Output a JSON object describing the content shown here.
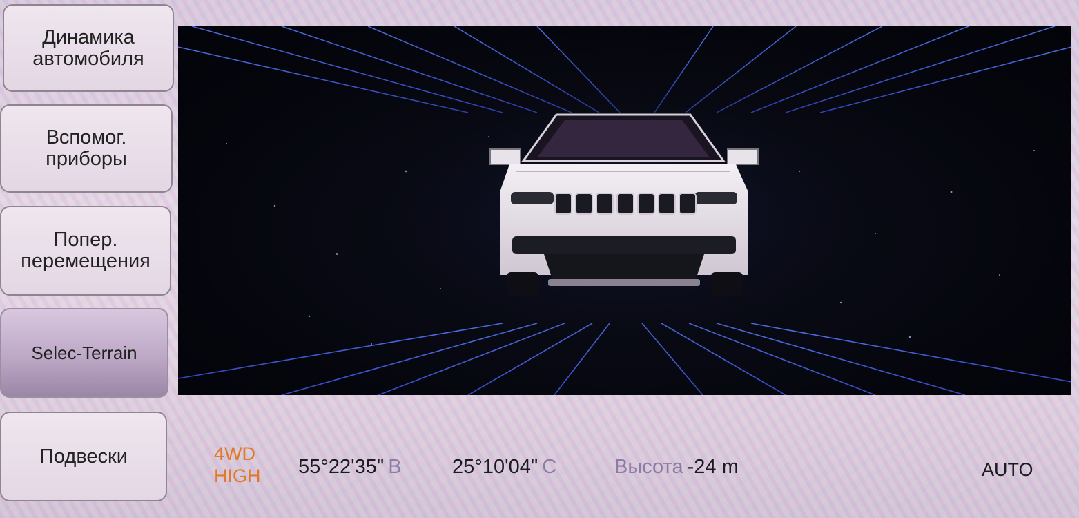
{
  "sidebar": {
    "items": [
      {
        "label_line1": "Динамика",
        "label_line2": "автомобиля",
        "active": false
      },
      {
        "label_line1": "Вспомог.",
        "label_line2": "приборы",
        "active": false
      },
      {
        "label_line1": "Попер.",
        "label_line2": "перемещения",
        "active": false
      },
      {
        "label_line1": "Selec-Terrain",
        "label_line2": "",
        "active": true
      },
      {
        "label_line1": "Подвески",
        "label_line2": "",
        "active": false
      }
    ]
  },
  "viewport": {
    "scene": "vehicle-front-view-neon-grid",
    "accent_color": "#4a6cff"
  },
  "status": {
    "drive_mode_line1": "4WD",
    "drive_mode_line2": "HIGH",
    "drive_mode_color": "#e07a2a",
    "latitude_value": "55°22'35\"",
    "latitude_dir": "В",
    "longitude_value": "25°10'04\"",
    "longitude_dir": "С",
    "altitude_label": "Высота",
    "altitude_value": "-24 m",
    "mode": "AUTO"
  }
}
